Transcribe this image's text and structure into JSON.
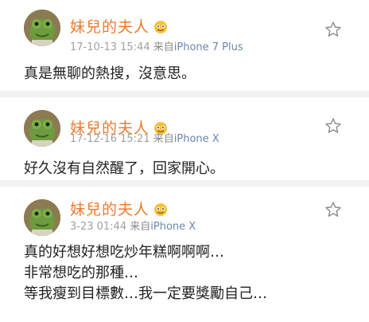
{
  "posts": [
    {
      "username": "妹兒的夫人",
      "time": "17-10-13 15:44",
      "source_prefix": "来自",
      "device": "iPhone 7 Plus",
      "lines": [
        "真是無聊的熱搜，沒意思。"
      ]
    },
    {
      "username": "妹兒的夫人",
      "time": "17-12-16 15:21",
      "source_prefix": "来自",
      "device": "iPhone X",
      "lines": [
        "好久沒有自然醒了，回家開心。"
      ]
    },
    {
      "username": "妹兒的夫人",
      "time": "3-23 01:44",
      "source_prefix": "来自",
      "device": "iPhone X",
      "lines": [
        "真的好想好想吃炒年糕啊啊啊…",
        "非常想吃的那種…",
        "等我瘦到目標數…我一定要獎勵自己…"
      ]
    }
  ],
  "icons": {
    "avatar": "frog-avatar-icon",
    "badge": "emoji-badge-icon",
    "favorite": "star-icon"
  },
  "colors": {
    "username": "#f07a2c",
    "meta": "#a0a0a0",
    "device": "#6a86b0",
    "text": "#222222",
    "divider": "#f2f2f2"
  }
}
